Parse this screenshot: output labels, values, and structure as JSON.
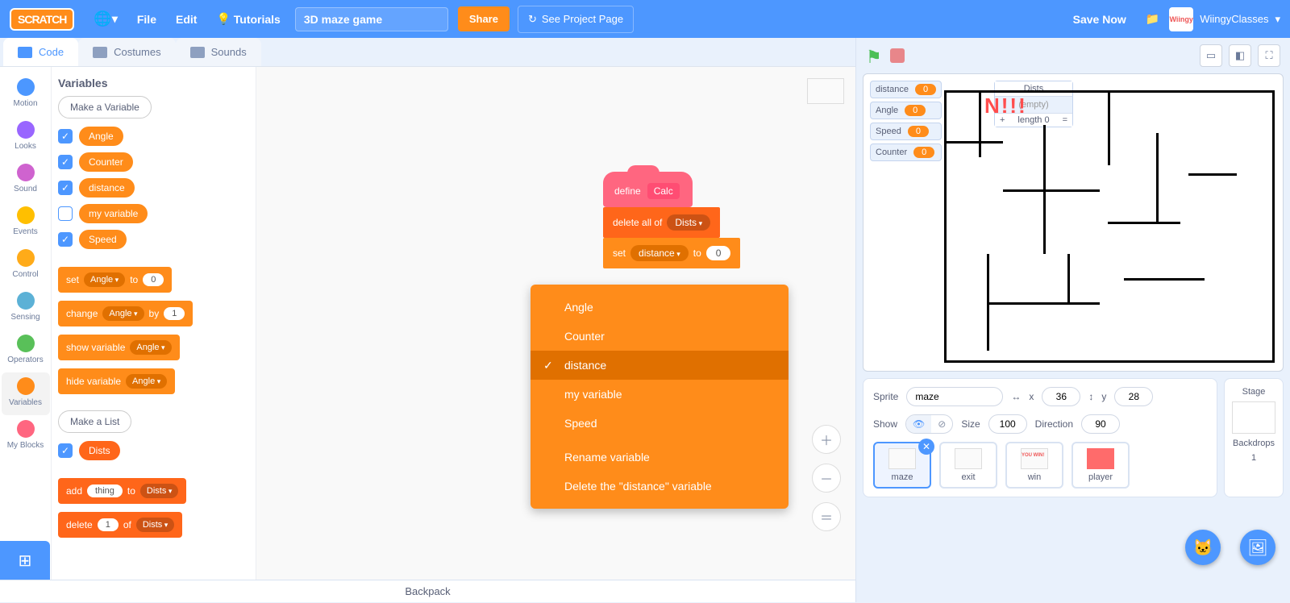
{
  "menubar": {
    "logo": "SCRATCH",
    "file": "File",
    "edit": "Edit",
    "tutorials": "Tutorials",
    "project_title": "3D maze game",
    "share": "Share",
    "see_project": "See Project Page",
    "save_now": "Save Now",
    "username": "WiingyClasses",
    "avatar_text": "Wiingy"
  },
  "tabs": {
    "code": "Code",
    "costumes": "Costumes",
    "sounds": "Sounds"
  },
  "categories": {
    "motion": "Motion",
    "looks": "Looks",
    "sound": "Sound",
    "events": "Events",
    "control": "Control",
    "sensing": "Sensing",
    "operators": "Operators",
    "variables": "Variables",
    "myblocks": "My Blocks"
  },
  "palette": {
    "heading": "Variables",
    "make_variable": "Make a Variable",
    "vars": [
      {
        "name": "Angle",
        "checked": true
      },
      {
        "name": "Counter",
        "checked": true
      },
      {
        "name": "distance",
        "checked": true
      },
      {
        "name": "my variable",
        "checked": false
      },
      {
        "name": "Speed",
        "checked": true
      }
    ],
    "set_block": {
      "label_set": "set",
      "var": "Angle",
      "label_to": "to",
      "val": "0"
    },
    "change_block": {
      "label_change": "change",
      "var": "Angle",
      "label_by": "by",
      "val": "1"
    },
    "show_block": {
      "label": "show variable",
      "var": "Angle"
    },
    "hide_block": {
      "label": "hide variable",
      "var": "Angle"
    },
    "make_list": "Make a List",
    "lists": [
      {
        "name": "Dists",
        "checked": true
      }
    ],
    "add_block": {
      "label_add": "add",
      "val": "thing",
      "label_to": "to",
      "list": "Dists"
    },
    "delete_block": {
      "label_delete": "delete",
      "val": "1",
      "label_of": "of",
      "list": "Dists"
    }
  },
  "script": {
    "define": {
      "label": "define",
      "name": "Calc"
    },
    "delete_all": {
      "label": "delete all of",
      "list": "Dists"
    },
    "set": {
      "label_set": "set",
      "var": "distance",
      "label_to": "to",
      "val": "0"
    }
  },
  "dropdown": {
    "items": [
      "Angle",
      "Counter",
      "distance",
      "my variable",
      "Speed"
    ],
    "selected": "distance",
    "rename": "Rename variable",
    "delete": "Delete the \"distance\" variable"
  },
  "stage": {
    "monitors": [
      {
        "label": "distance",
        "value": "0"
      },
      {
        "label": "Angle",
        "value": "0"
      },
      {
        "label": "Speed",
        "value": "0"
      },
      {
        "label": "Counter",
        "value": "0"
      }
    ],
    "list_monitor": {
      "title": "Dists",
      "empty": "(empty)",
      "plus": "+",
      "length": "length 0",
      "eq": "="
    },
    "win_text": "N!!!"
  },
  "sprite_info": {
    "sprite_label": "Sprite",
    "name": "maze",
    "x_label": "x",
    "x": "36",
    "y_label": "y",
    "y": "28",
    "show_label": "Show",
    "size_label": "Size",
    "size": "100",
    "direction_label": "Direction",
    "direction": "90"
  },
  "sprites": [
    {
      "name": "maze",
      "selected": true,
      "thumb": "maze"
    },
    {
      "name": "exit",
      "selected": false,
      "thumb": "blank"
    },
    {
      "name": "win",
      "selected": false,
      "thumb": "win"
    },
    {
      "name": "player",
      "selected": false,
      "thumb": "red"
    }
  ],
  "stage_panel": {
    "label": "Stage",
    "backdrops_label": "Backdrops",
    "backdrops_count": "1"
  },
  "backpack": "Backpack"
}
